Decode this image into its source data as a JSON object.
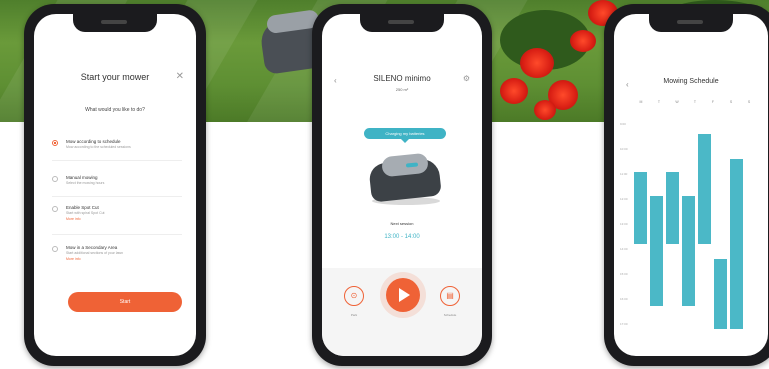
{
  "banner": {
    "colors": {
      "grass": "#5e8f33",
      "flower": "#d91f14"
    }
  },
  "phone1": {
    "title": "Start your mower",
    "close_icon": "close-icon",
    "question": "What would you like to do?",
    "options": [
      {
        "title": "Mow according to schedule",
        "subtitle": "Mow according to the scheduled sessions",
        "link": "",
        "selected": true
      },
      {
        "title": "Manual mowing",
        "subtitle": "Select the mowing hours",
        "link": "",
        "selected": false
      },
      {
        "title": "Enable Spot Cut",
        "subtitle": "Start with spiral Spot Cut",
        "link": "More info",
        "selected": false
      },
      {
        "title": "Mow in a Secondary Area",
        "subtitle": "Start additional sections of your lawn",
        "link": "More info",
        "selected": false
      }
    ],
    "start_button": "Start",
    "accent_color": "#ef6236"
  },
  "phone2": {
    "title": "SILENO minimo",
    "subtitle": "250 m²",
    "status_pill": "Charging my batteries",
    "next_label": "Next session",
    "next_time": "13:00 - 14:00",
    "left_label": "Park",
    "right_label": "Schedule",
    "play_icon": "play-icon",
    "accent_color": "#3fb3c5"
  },
  "phone3": {
    "title": "Mowing Schedule",
    "days": [
      "M",
      "T",
      "W",
      "T",
      "F",
      "S",
      "S"
    ],
    "hours": [
      "9:00",
      "10:00",
      "11:00",
      "12:00",
      "13:00",
      "14:00",
      "15:00",
      "16:00",
      "17:00",
      "18:00"
    ],
    "bar_color": "#4bb8c7"
  }
}
